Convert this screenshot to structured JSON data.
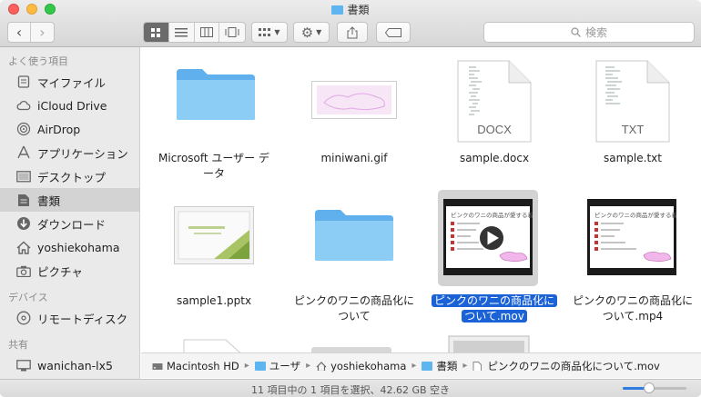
{
  "window": {
    "title": "書類"
  },
  "toolbar": {
    "back": "‹",
    "forward": "›",
    "search_placeholder": "検索",
    "search_icon": "magnifier-icon"
  },
  "sidebar": {
    "favorites_header": "よく使う項目",
    "favorites": [
      {
        "label": "マイファイル",
        "icon": "all-files-icon"
      },
      {
        "label": "iCloud Drive",
        "icon": "cloud-icon"
      },
      {
        "label": "AirDrop",
        "icon": "airdrop-icon"
      },
      {
        "label": "アプリケーション",
        "icon": "applications-icon"
      },
      {
        "label": "デスクトップ",
        "icon": "desktop-icon"
      },
      {
        "label": "書類",
        "icon": "documents-icon",
        "selected": true
      },
      {
        "label": "ダウンロード",
        "icon": "download-icon"
      },
      {
        "label": "yoshiekohama",
        "icon": "home-icon"
      },
      {
        "label": "ピクチャ",
        "icon": "camera-icon"
      }
    ],
    "devices_header": "デバイス",
    "devices": [
      {
        "label": "リモートディスク",
        "icon": "disc-icon"
      }
    ],
    "shared_header": "共有",
    "shared": [
      {
        "label": "wanichan-lx5",
        "icon": "computer-icon"
      }
    ]
  },
  "files": [
    {
      "name": "Microsoft ユーザー データ",
      "line1": "Microsoft ユーザー デ",
      "line2": "ータ",
      "kind": "folder"
    },
    {
      "name": "miniwani.gif",
      "line1": "miniwani.gif",
      "line2": "",
      "kind": "gif"
    },
    {
      "name": "sample.docx",
      "line1": "sample.docx",
      "line2": "",
      "kind": "doc",
      "badge": "DOCX"
    },
    {
      "name": "sample.txt",
      "line1": "sample.txt",
      "line2": "",
      "kind": "doc",
      "badge": "TXT"
    },
    {
      "name": "sample1.pptx",
      "line1": "sample1.pptx",
      "line2": "",
      "kind": "pptx"
    },
    {
      "name": "ピンクのワニの商品化について",
      "line1": "ピンクのワニの商品化に",
      "line2": "ついて",
      "kind": "folder"
    },
    {
      "name": "ピンクのワニの商品化について.mov",
      "line1": "ピンクのワニの商品化に",
      "line2": "ついて.mov",
      "kind": "video",
      "selected": true
    },
    {
      "name": "ピンクのワニの商品化について.mp4",
      "line1": "ピンクのワニの商品化に",
      "line2": "ついて.mp4",
      "kind": "video"
    }
  ],
  "slide_title": "ピンクのワニの商品が愛する着層",
  "pathbar": [
    {
      "label": "Macintosh HD",
      "icon": "hard-drive-icon"
    },
    {
      "label": "ユーザ",
      "icon": "folder-icon"
    },
    {
      "label": "yoshiekohama",
      "icon": "home-icon"
    },
    {
      "label": "書類",
      "icon": "folder-icon"
    },
    {
      "label": "ピンクのワニの商品化について.mov",
      "icon": "movie-file-icon"
    }
  ],
  "status": {
    "text": "11 項目中の 1 項目を選択、42.62 GB 空き",
    "icon_size_level": 0.42
  },
  "colors": {
    "selection": "#1a62d6",
    "folder": "#5fb5f0"
  }
}
